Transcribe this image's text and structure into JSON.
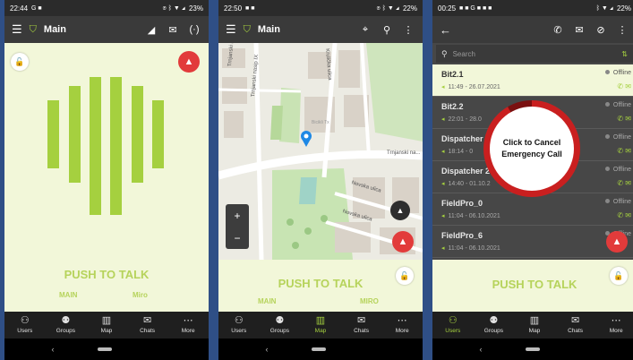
{
  "phone1": {
    "status": {
      "time": "22:44",
      "left_icons": "G ■",
      "battery": "23%"
    },
    "appbar": {
      "title": "Main"
    },
    "ptt": {
      "label": "PUSH TO TALK",
      "channel": "MAIN",
      "user": "Miro"
    },
    "nav": [
      {
        "label": "Users",
        "icon": "users-icon"
      },
      {
        "label": "Groups",
        "icon": "groups-icon"
      },
      {
        "label": "Map",
        "icon": "map-icon"
      },
      {
        "label": "Chats",
        "icon": "chats-icon"
      },
      {
        "label": "More",
        "icon": "more-icon"
      }
    ]
  },
  "phone2": {
    "status": {
      "time": "22:50",
      "left_icons": "■ ■",
      "battery": "22%"
    },
    "appbar": {
      "title": "Main"
    },
    "map_labels": {
      "street1": "Trnjanski nasip X",
      "street2": "Trnjanski nasip IX",
      "street3": "Krulička ulica",
      "street4": "Trnjanski na...",
      "street5": "Novska ulica",
      "street6": "Novska ulica",
      "poi": "Bicikli Tx"
    },
    "ptt": {
      "label": "PUSH TO TALK",
      "channel": "MAIN",
      "user": "MIRO"
    },
    "nav": [
      {
        "label": "Users"
      },
      {
        "label": "Groups"
      },
      {
        "label": "Map"
      },
      {
        "label": "Chats"
      },
      {
        "label": "More"
      }
    ]
  },
  "phone3": {
    "status": {
      "time": "00:25",
      "left_icons": "■ ■ G ■ ■ ■",
      "battery": "22%"
    },
    "search": {
      "placeholder": "Search"
    },
    "users": [
      {
        "name": "Bit2.1",
        "meta": "11:49 - 26.07.2021",
        "status": "Offline",
        "selected": true
      },
      {
        "name": "Bit2.2",
        "meta": "22:01 - 28.0",
        "status": "Offline",
        "selected": false
      },
      {
        "name": "Dispatcher",
        "meta": "18:14 - 0",
        "status": "Offline",
        "selected": false
      },
      {
        "name": "Dispatcher 2",
        "meta": "14:40 - 01.10.2",
        "status": "Offline",
        "selected": false
      },
      {
        "name": "FieldPro_0",
        "meta": "11:04 - 06.10.2021",
        "status": "Offline",
        "selected": false
      },
      {
        "name": "FieldPro_6",
        "meta": "11:04 - 06.10.2021",
        "status": "Offline",
        "selected": false
      }
    ],
    "emergency": {
      "line1": "Click to Cancel",
      "line2": "Emergency Call"
    },
    "ptt": {
      "label": "PUSH TO TALK"
    },
    "nav": [
      {
        "label": "Users"
      },
      {
        "label": "Groups"
      },
      {
        "label": "Map"
      },
      {
        "label": "Chats"
      },
      {
        "label": "More"
      }
    ]
  },
  "colors": {
    "accent": "#a5d03f",
    "emergency": "#e23b3b",
    "ptt_bg": "#f2f7d9",
    "appbar": "#3a3a3a"
  }
}
